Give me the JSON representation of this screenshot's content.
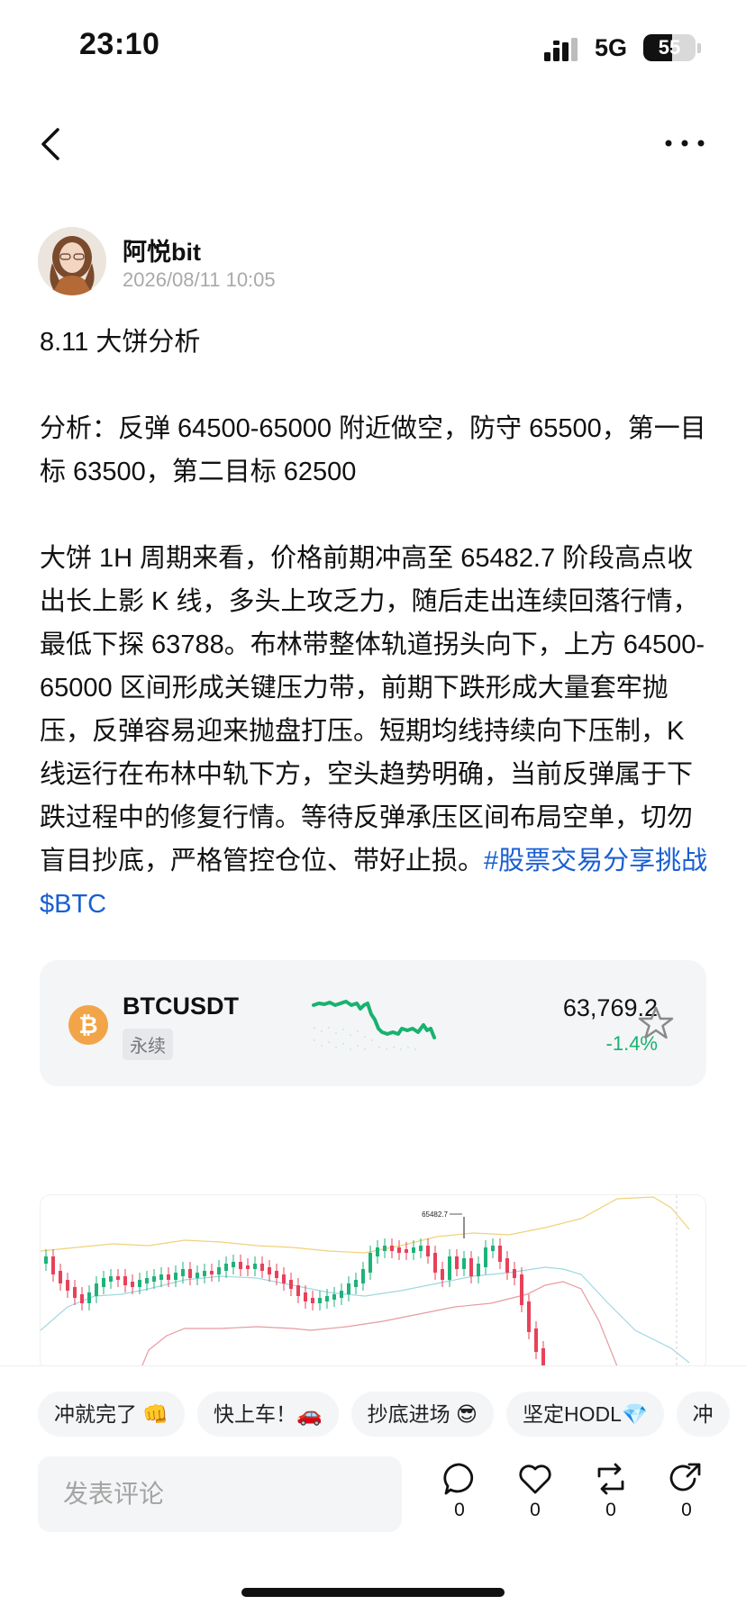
{
  "status_bar": {
    "time": "23:10",
    "network": "5G",
    "battery_level": "55",
    "battery_fraction": 0.55
  },
  "nav": {
    "back_icon": "chevron-left-icon",
    "more_icon": "more-horizontal-icon"
  },
  "author": {
    "name": "阿悦bit",
    "datetime": "2026/08/11 10:05"
  },
  "post": {
    "title": "8.11 大饼分析",
    "analysis": "分析：反弹 64500-65000 附近做空，防守 65500，第一目标 63500，第二目标 62500",
    "body": "大饼 1H 周期来看，价格前期冲高至 65482.7 阶段高点收出长上影 K 线，多头上攻乏力，随后走出连续回落行情，最低下探 63788。布林带整体轨道拐头向下，上方 64500-65000 区间形成关键压力带，前期下跌形成大量套牢抛压，反弹容易迎来抛盘打压。短期均线持续向下压制，K 线运行在布林中轨下方，空头趋势明确，当前反弹属于下跌过程中的修复行情。等待反弹承压区间布局空单，切勿盲目抄底，严格管控仓位、带好止损。",
    "hashtag": "#股票交易分享挑战",
    "cashtag": "$BTC"
  },
  "ticker": {
    "symbol": "BTCUSDT",
    "contract_type": "永续",
    "price": "63,769.2",
    "change": "-1.4%",
    "up_color": "#18b26f",
    "coin_icon": "bitcoin-icon",
    "favorite_icon": "star-outline-icon"
  },
  "chart": {
    "high_label": "65482.7",
    "up_color": "#1fb27a",
    "down_color": "#e8415a"
  },
  "bottom_bar": {
    "chips": [
      "冲就完了 👊",
      "快上车！🚗",
      "抄底进场 😎",
      "坚定HODL💎",
      "冲"
    ],
    "comment_placeholder": "发表评论",
    "actions": [
      {
        "icon": "comment-icon",
        "count": "0"
      },
      {
        "icon": "heart-icon",
        "count": "0"
      },
      {
        "icon": "repost-icon",
        "count": "0"
      },
      {
        "icon": "share-icon",
        "count": "0"
      }
    ]
  }
}
